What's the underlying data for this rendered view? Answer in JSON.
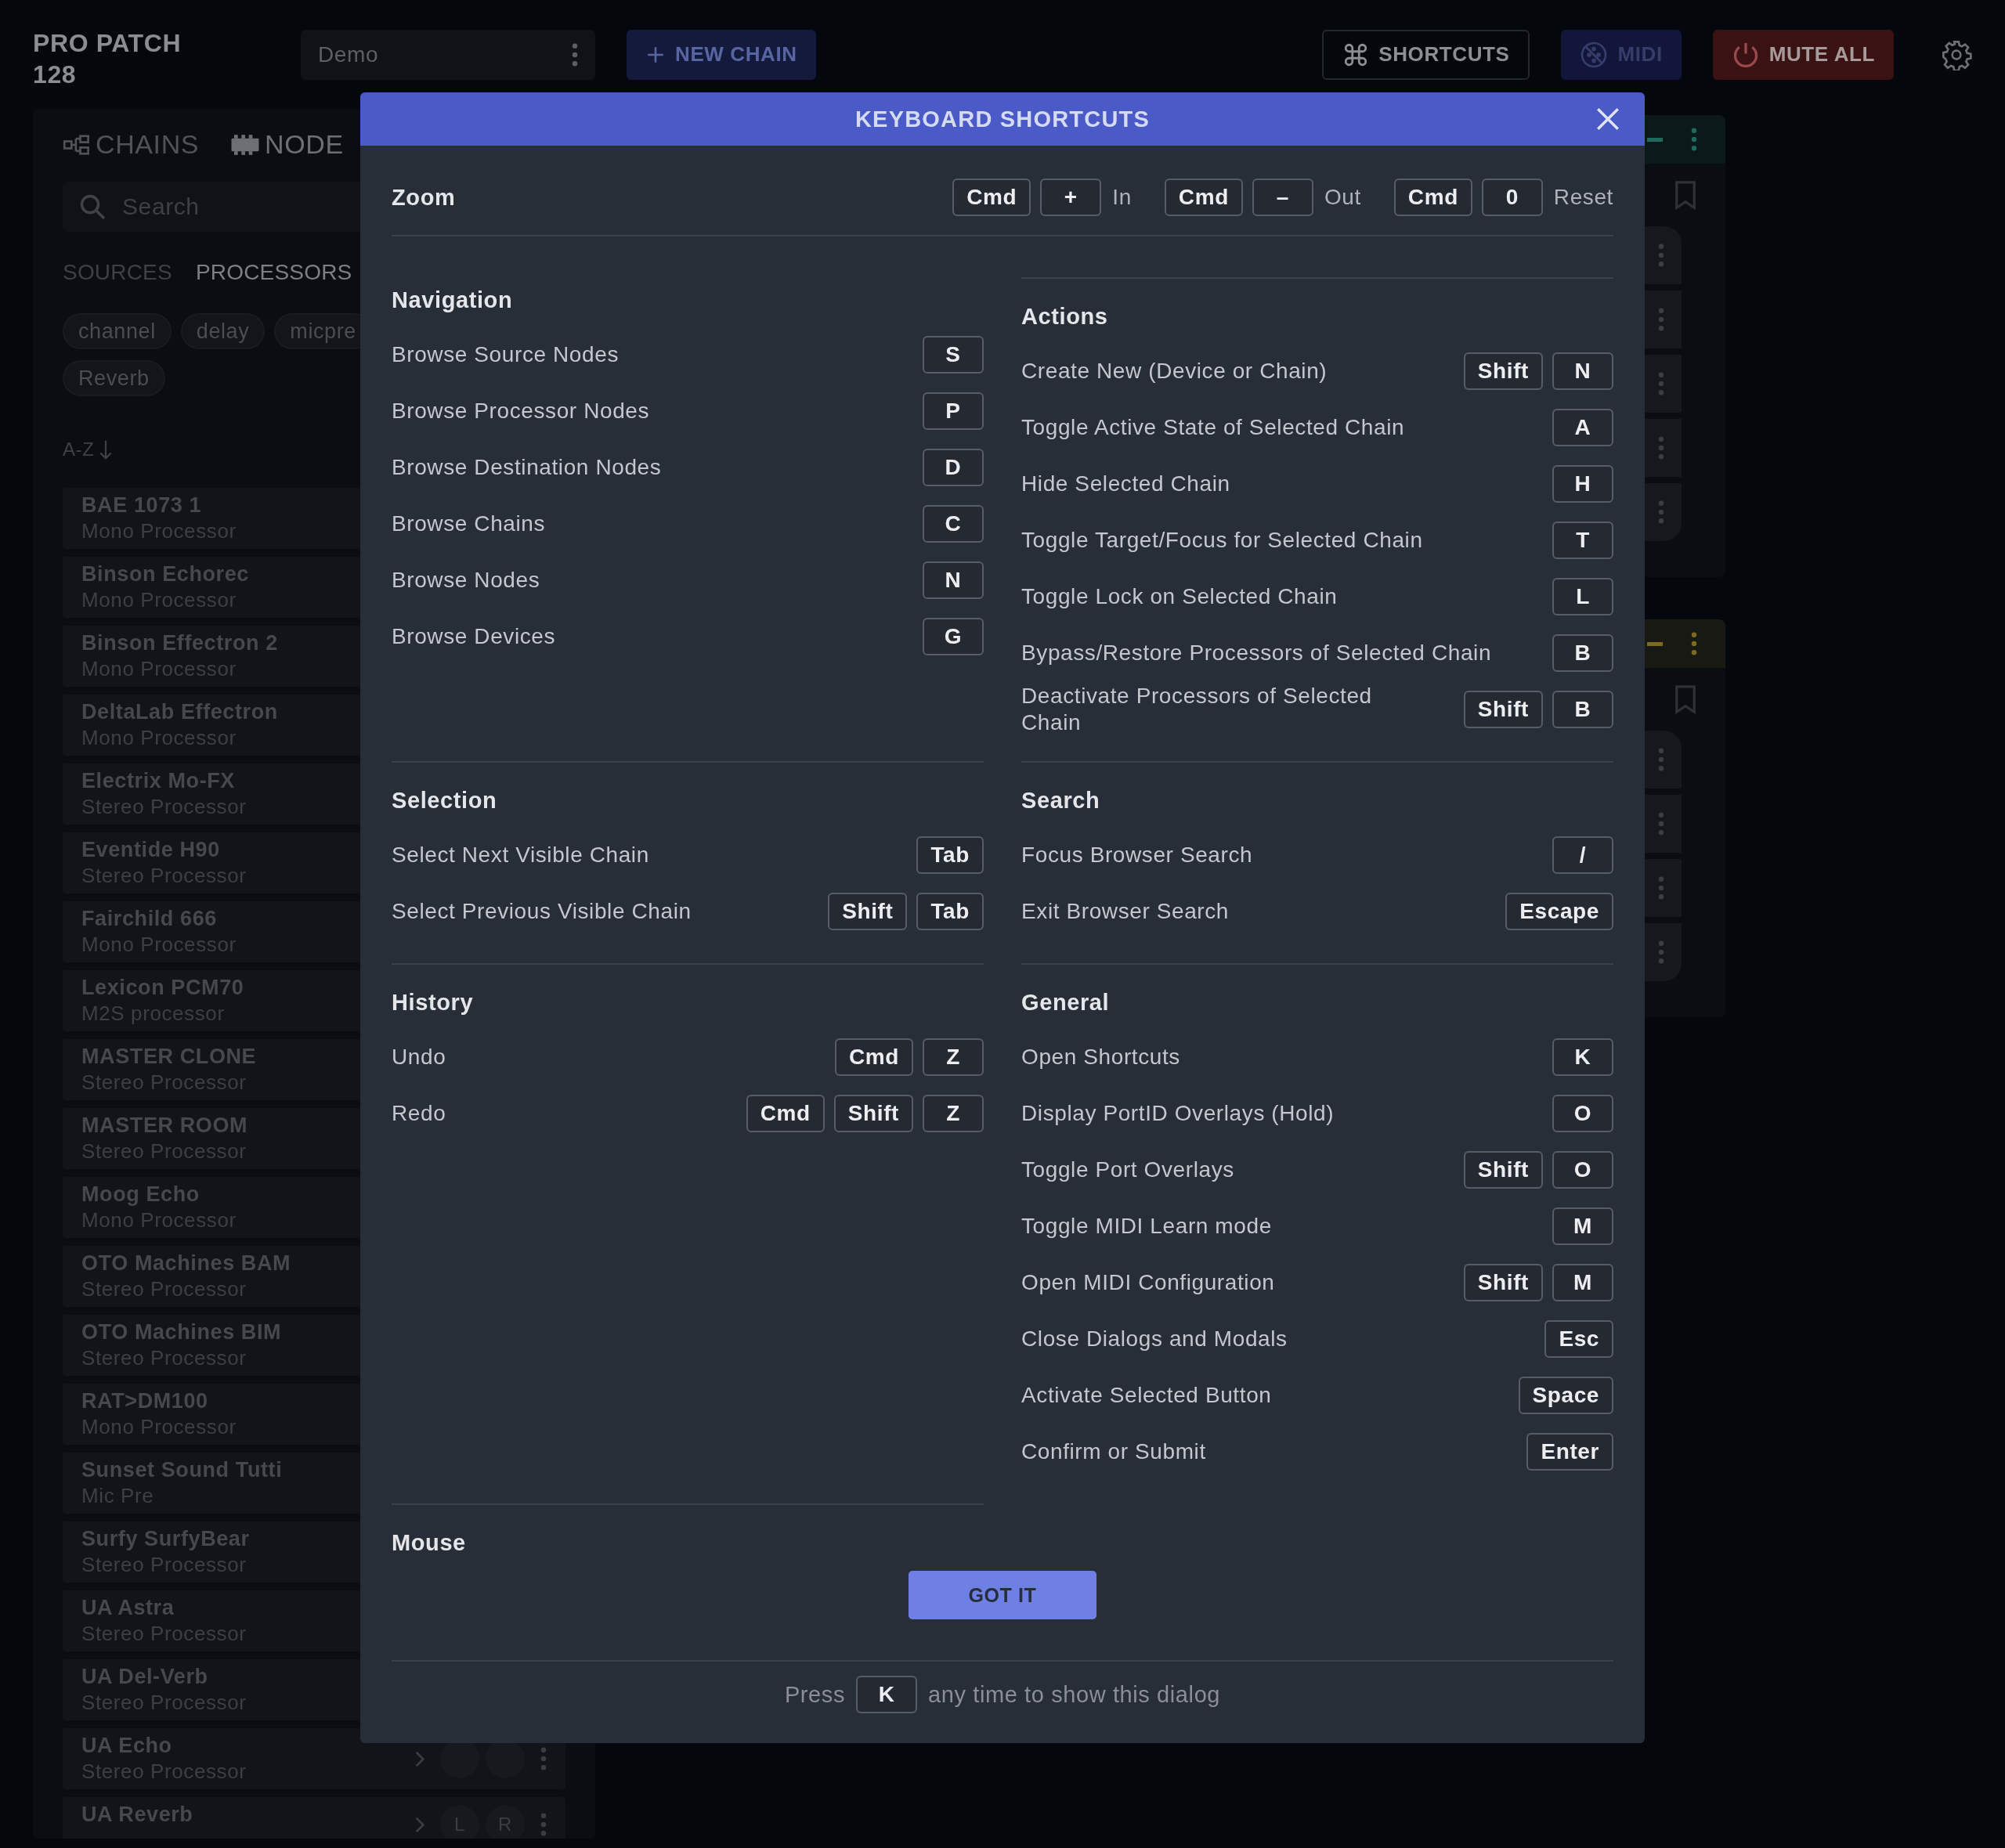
{
  "app": {
    "title": "PRO PATCH 128"
  },
  "toolbar": {
    "preset": {
      "value": "Demo"
    },
    "new_chain": {
      "label": "NEW CHAIN"
    },
    "shortcuts": {
      "label": "SHORTCUTS"
    },
    "midi": {
      "label": "MIDI"
    },
    "mute_all": {
      "label": "MUTE ALL"
    }
  },
  "sidebar": {
    "tabs": [
      {
        "label": "CHAINS",
        "kind": "chains",
        "selected": false
      },
      {
        "label": "NODE",
        "kind": "nodes",
        "selected": true
      }
    ],
    "search": {
      "placeholder": "Search"
    },
    "categories": [
      {
        "label": "SOURCES",
        "selected": false
      },
      {
        "label": "PROCESSORS",
        "selected": true
      }
    ],
    "tag_rows": [
      [
        "channel",
        "delay",
        "micpre"
      ],
      [
        "Reverb"
      ]
    ],
    "sort": {
      "label": "A-Z"
    },
    "items": [
      {
        "name": "BAE 1073 1",
        "type": "Mono Processor"
      },
      {
        "name": "Binson Echorec",
        "type": "Mono Processor"
      },
      {
        "name": "Binson Effectron 2",
        "type": "Mono Processor"
      },
      {
        "name": "DeltaLab Effectron",
        "type": "Mono Processor"
      },
      {
        "name": "Electrix Mo-FX",
        "type": "Stereo Processor"
      },
      {
        "name": "Eventide H90",
        "type": "Stereo Processor"
      },
      {
        "name": "Fairchild 666",
        "type": "Mono Processor"
      },
      {
        "name": "Lexicon PCM70",
        "type": "M2S processor"
      },
      {
        "name": "MASTER CLONE",
        "type": "Stereo Processor"
      },
      {
        "name": "MASTER ROOM",
        "type": "Stereo Processor"
      },
      {
        "name": "Moog Echo",
        "type": "Mono Processor"
      },
      {
        "name": "OTO Machines BAM",
        "type": "Stereo Processor"
      },
      {
        "name": "OTO Machines BIM",
        "type": "Stereo Processor"
      },
      {
        "name": "RAT>DM100",
        "type": "Mono Processor"
      },
      {
        "name": "Sunset Sound Tutti",
        "type": "Mic Pre"
      },
      {
        "name": "Surfy SurfyBear",
        "type": "Stereo Processor"
      },
      {
        "name": "UA Astra",
        "type": "Stereo Processor"
      },
      {
        "name": "UA Del-Verb",
        "type": "Stereo Processor"
      },
      {
        "name": "UA Echo",
        "type": "Stereo Processor",
        "kind": "controls"
      },
      {
        "name": "UA Reverb",
        "kind": "controls",
        "channels": [
          "L",
          "R"
        ]
      }
    ]
  },
  "chains": [
    {
      "color": "#1e6a5c",
      "nodes": [
        {
          "kind": "node"
        },
        {
          "kind": "node"
        },
        {
          "kind": "node"
        },
        {
          "kind": "node"
        },
        {
          "kind": "node"
        }
      ]
    },
    {
      "color": "#7a6a22",
      "nodes": [
        {
          "kind": "node"
        },
        {
          "kind": "node"
        },
        {
          "kind": "node"
        },
        {
          "kind": "node"
        }
      ]
    }
  ],
  "dialog": {
    "title": "KEYBOARD SHORTCUTS",
    "zoom": {
      "heading": "Zoom",
      "bindings": [
        {
          "keys": [
            "Cmd",
            "+"
          ],
          "label": "In"
        },
        {
          "keys": [
            "Cmd",
            "–"
          ],
          "label": "Out"
        },
        {
          "keys": [
            "Cmd",
            "0"
          ],
          "label": "Reset"
        }
      ]
    },
    "sections": [
      {
        "heading": "Navigation",
        "rows": [
          {
            "action": "Browse Source Nodes",
            "keys": [
              "S"
            ]
          },
          {
            "action": "Browse Processor Nodes",
            "keys": [
              "P"
            ]
          },
          {
            "action": "Browse Destination Nodes",
            "keys": [
              "D"
            ]
          },
          {
            "action": "Browse Chains",
            "keys": [
              "C"
            ]
          },
          {
            "action": "Browse Nodes",
            "keys": [
              "N"
            ]
          },
          {
            "action": "Browse Devices",
            "keys": [
              "G"
            ]
          }
        ]
      },
      {
        "heading": "Actions",
        "rows": [
          {
            "action": "Create New (Device or Chain)",
            "keys": [
              "Shift",
              "N"
            ]
          },
          {
            "action": "Toggle Active State of Selected Chain",
            "keys": [
              "A"
            ]
          },
          {
            "action": "Hide Selected Chain",
            "keys": [
              "H"
            ]
          },
          {
            "action": "Toggle Target/Focus for Selected Chain",
            "keys": [
              "T"
            ]
          },
          {
            "action": "Toggle Lock on Selected Chain",
            "keys": [
              "L"
            ]
          },
          {
            "action": "Bypass/Restore Processors of Selected Chain",
            "keys": [
              "B"
            ]
          },
          {
            "action": "Deactivate Processors of Selected Chain",
            "keys": [
              "Shift",
              "B"
            ]
          }
        ]
      },
      {
        "heading": "Selection",
        "rows": [
          {
            "action": "Select Next Visible Chain",
            "keys": [
              "Tab"
            ]
          },
          {
            "action": "Select Previous Visible Chain",
            "keys": [
              "Shift",
              "Tab"
            ]
          }
        ]
      },
      {
        "heading": "Search",
        "rows": [
          {
            "action": "Focus Browser Search",
            "keys": [
              "/"
            ]
          },
          {
            "action": "Exit Browser Search",
            "keys": [
              "Escape"
            ]
          }
        ]
      },
      {
        "heading": "History",
        "rows": [
          {
            "action": "Undo",
            "keys": [
              "Cmd",
              "Z"
            ]
          },
          {
            "action": "Redo",
            "keys": [
              "Cmd",
              "Shift",
              "Z"
            ]
          }
        ]
      },
      {
        "heading": "General",
        "rows": [
          {
            "action": "Open Shortcuts",
            "keys": [
              "K"
            ]
          },
          {
            "action": "Display PortID Overlays (Hold)",
            "keys": [
              "O"
            ]
          },
          {
            "action": "Toggle Port Overlays",
            "keys": [
              "Shift",
              "O"
            ]
          },
          {
            "action": "Toggle MIDI Learn mode",
            "keys": [
              "M"
            ]
          },
          {
            "action": "Open MIDI Configuration",
            "keys": [
              "Shift",
              "M"
            ]
          },
          {
            "action": "Close Dialogs and Modals",
            "keys": [
              "Esc"
            ]
          },
          {
            "action": "Activate Selected Button",
            "keys": [
              "Space"
            ]
          },
          {
            "action": "Confirm or Submit",
            "keys": [
              "Enter"
            ]
          }
        ]
      },
      {
        "heading": "Mouse"
      }
    ],
    "button": {
      "label": "GOT IT"
    },
    "footer": {
      "before": "Press",
      "key": "K",
      "after": "any time to show this dialog"
    }
  }
}
